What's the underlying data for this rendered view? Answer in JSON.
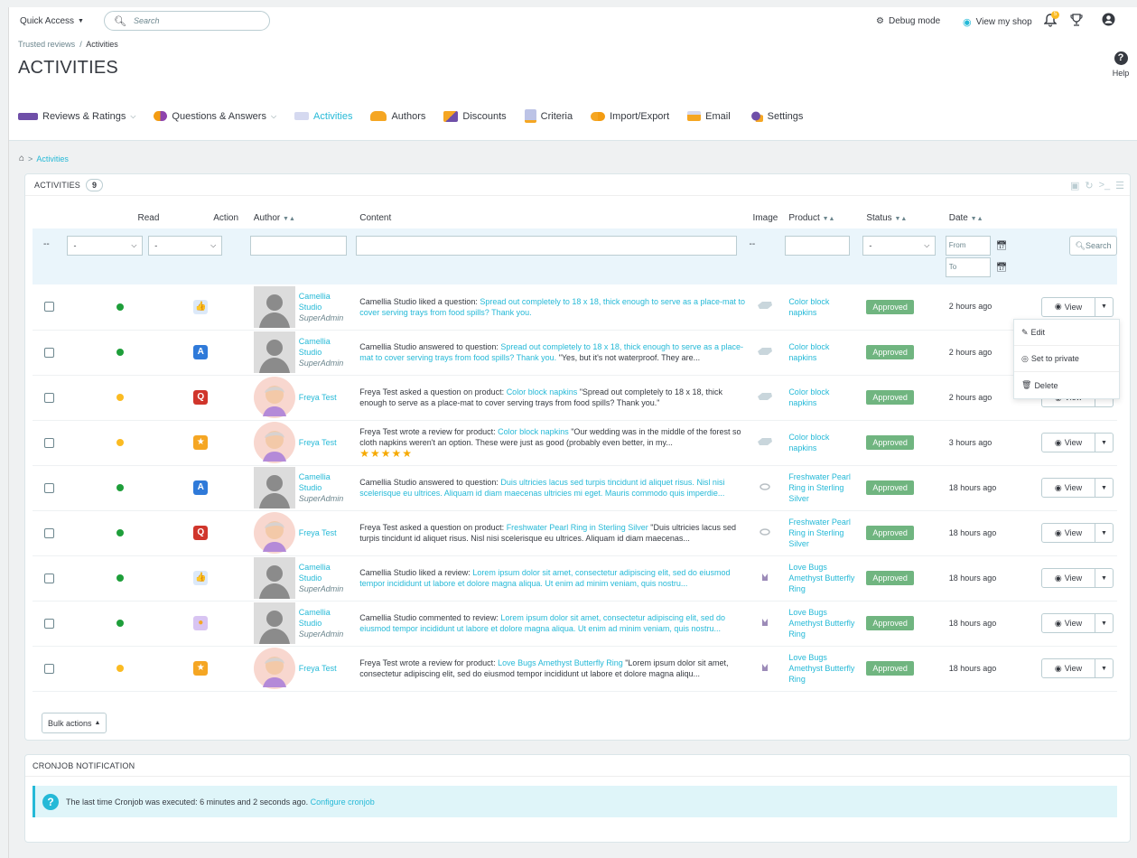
{
  "header": {
    "quick_access": "Quick Access",
    "search_placeholder": "Search",
    "debug_mode": "Debug mode",
    "view_shop": "View my shop",
    "notif_count": "5",
    "help": "Help"
  },
  "breadcrumb": {
    "parent": "Trusted reviews",
    "current": "Activities"
  },
  "page_title": "ACTIVITIES",
  "tabs": [
    {
      "label": "Reviews & Ratings"
    },
    {
      "label": "Questions & Answers"
    },
    {
      "label": "Activities"
    },
    {
      "label": "Authors"
    },
    {
      "label": "Discounts"
    },
    {
      "label": "Criteria"
    },
    {
      "label": "Import/Export"
    },
    {
      "label": "Email"
    },
    {
      "label": "Settings"
    }
  ],
  "sub_breadcrumb": "Activities",
  "panel": {
    "title": "ACTIVITIES",
    "count": "9",
    "columns": {
      "dash": "--",
      "read": "Read",
      "action": "Action",
      "author": "Author",
      "content": "Content",
      "image": "Image",
      "product": "Product",
      "status": "Status",
      "date": "Date"
    },
    "filters": {
      "read_value": "-",
      "action_value": "-",
      "status_value": "-",
      "image_dash": "--",
      "from_placeholder": "From",
      "to_placeholder": "To",
      "search_button": "Search"
    },
    "bulk_actions": "Bulk actions",
    "view_label": "View"
  },
  "rows": [
    {
      "author": "Camellia Studio",
      "role": "SuperAdmin",
      "pre": "Camellia Studio liked a question: ",
      "link": "Spread out completely to 18 x 18, thick enough to serve as a place-mat to cover serving trays from food spills? Thank you.",
      "post": "",
      "product": "Color block napkins",
      "status": "Approved",
      "date": "2 hours ago"
    },
    {
      "author": "Camellia Studio",
      "role": "SuperAdmin",
      "pre": "Camellia Studio answered to question: ",
      "link": "Spread out completely to 18 x 18, thick enough to serve as a place-mat to cover serving trays from food spills? Thank you.",
      "post": " \"Yes, but it's not waterproof. They are...",
      "product": "Color block napkins",
      "status": "Approved",
      "date": "2 hours ago"
    },
    {
      "author": "Freya Test",
      "role": "",
      "pre": "Freya Test asked a question on product: ",
      "link": "Color block napkins",
      "post": " \"Spread out completely to 18 x 18, thick enough to serve as a place-mat to cover serving trays from food spills? Thank you.\"",
      "product": "Color block napkins",
      "status": "Approved",
      "date": "2 hours ago"
    },
    {
      "author": "Freya Test",
      "role": "",
      "pre": "Freya Test wrote a review for product: ",
      "link": "Color block napkins",
      "post": " \"Our wedding was in the middle of the forest so cloth napkins weren't an option. These were just as good (probably even better, in my...",
      "product": "Color block napkins",
      "status": "Approved",
      "date": "3 hours ago",
      "stars": "★★★★★"
    },
    {
      "author": "Camellia Studio",
      "role": "SuperAdmin",
      "pre": "Camellia Studio answered to question: ",
      "link": "Duis ultricies lacus sed turpis tincidunt id aliquet risus. Nisl nisi scelerisque eu ultrices. Aliquam id diam maecenas ultricies mi eget. Mauris commodo quis imperdie...",
      "post": "",
      "product": "Freshwater Pearl Ring in Sterling Silver",
      "status": "Approved",
      "date": "18 hours ago"
    },
    {
      "author": "Freya Test",
      "role": "",
      "pre": "Freya Test asked a question on product: ",
      "link": "Freshwater Pearl Ring in Sterling Silver",
      "post": " \"Duis ultricies lacus sed turpis tincidunt id aliquet risus. Nisl nisi scelerisque eu ultrices. Aliquam id diam maecenas...",
      "product": "Freshwater Pearl Ring in Sterling Silver",
      "status": "Approved",
      "date": "18 hours ago"
    },
    {
      "author": "Camellia Studio",
      "role": "SuperAdmin",
      "pre": "Camellia Studio liked a review: ",
      "link": "Lorem ipsum dolor sit amet, consectetur adipiscing elit, sed do eiusmod tempor incididunt ut labore et dolore magna aliqua. Ut enim ad minim veniam, quis nostru...",
      "post": "",
      "product": "Love Bugs Amethyst Butterfly Ring",
      "status": "Approved",
      "date": "18 hours ago"
    },
    {
      "author": "Camellia Studio",
      "role": "SuperAdmin",
      "pre": "Camellia Studio commented to review: ",
      "link": "Lorem ipsum dolor sit amet, consectetur adipiscing elit, sed do eiusmod tempor incididunt ut labore et dolore magna aliqua. Ut enim ad minim veniam, quis nostru...",
      "post": "",
      "product": "Love Bugs Amethyst Butterfly Ring",
      "status": "Approved",
      "date": "18 hours ago"
    },
    {
      "author": "Freya Test",
      "role": "",
      "pre": "Freya Test wrote a review for product: ",
      "link": "Love Bugs Amethyst Butterfly Ring",
      "post": " \"Lorem ipsum dolor sit amet, consectetur adipiscing elit, sed do eiusmod tempor incididunt ut labore et dolore magna aliqu...",
      "product": "Love Bugs Amethyst Butterfly Ring",
      "status": "Approved",
      "date": "18 hours ago"
    }
  ],
  "dropdown": {
    "edit": "Edit",
    "private": "Set to private",
    "delete": "Delete"
  },
  "cron": {
    "title": "CRONJOB NOTIFICATION",
    "message": "The last time Cronjob was executed: 6 minutes and 2 seconds ago. ",
    "link": "Configure cronjob"
  },
  "colors": {
    "accent": "#25b9d7",
    "approved": "#70b580",
    "read_green": "#1e9e3a",
    "unread_yellow": "#fbbb22"
  }
}
